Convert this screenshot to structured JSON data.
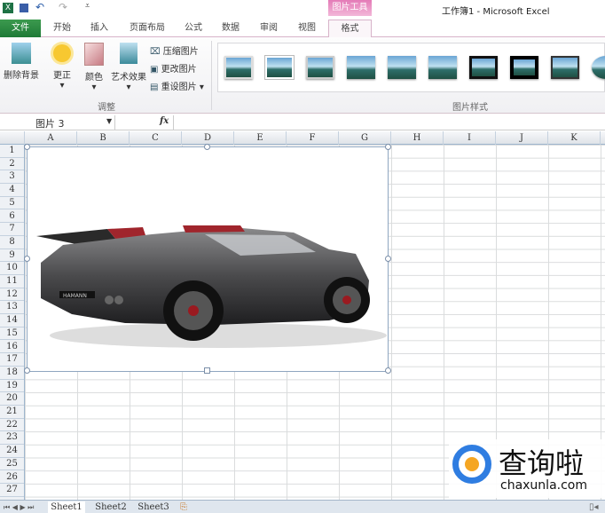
{
  "title": "工作簿1 - Microsoft Excel",
  "context_tab": "图片工具",
  "tabs": [
    "文件",
    "开始",
    "插入",
    "页面布局",
    "公式",
    "数据",
    "审阅",
    "视图",
    "格式"
  ],
  "adjust": {
    "remove_bg": "删除背景",
    "corrections": "更正",
    "color": "颜色",
    "artistic": "艺术效果",
    "compress": "压缩图片",
    "change": "更改图片",
    "reset": "重设图片",
    "group": "调整"
  },
  "styles_group": "图片样式",
  "name_box": "图片 3",
  "fx": "fx",
  "columns": [
    "A",
    "B",
    "C",
    "D",
    "E",
    "F",
    "G",
    "H",
    "I",
    "J",
    "K"
  ],
  "rows": [
    "1",
    "2",
    "3",
    "4",
    "5",
    "6",
    "7",
    "8",
    "9",
    "10",
    "11",
    "12",
    "13",
    "14",
    "15",
    "16",
    "17",
    "18",
    "19",
    "20",
    "21",
    "22",
    "23",
    "24",
    "25",
    "26",
    "27"
  ],
  "sheets": [
    "Sheet1",
    "Sheet2",
    "Sheet3"
  ],
  "watermark": {
    "name": "查询啦",
    "url": "chaxunla.com"
  },
  "car_plate": "HAMANN"
}
